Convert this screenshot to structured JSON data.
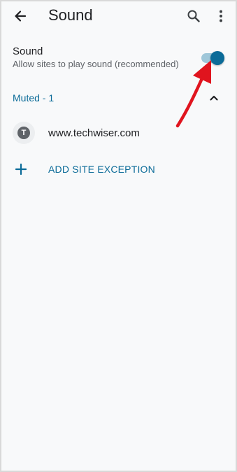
{
  "appbar": {
    "title": "Sound",
    "back_icon": "arrow-back-icon",
    "search_icon": "search-icon",
    "more_icon": "more-vert-icon"
  },
  "setting": {
    "title": "Sound",
    "summary": "Allow sites to play sound (recommended)",
    "toggle_on": true
  },
  "group": {
    "label": "Muted - 1",
    "expanded": true
  },
  "sites": [
    {
      "favicon_letter": "T",
      "url": "www.techwiser.com"
    }
  ],
  "add_exception": {
    "label": "ADD SITE EXCEPTION"
  },
  "colors": {
    "accent": "#0b6b98",
    "annotation_arrow": "#e0141e"
  }
}
